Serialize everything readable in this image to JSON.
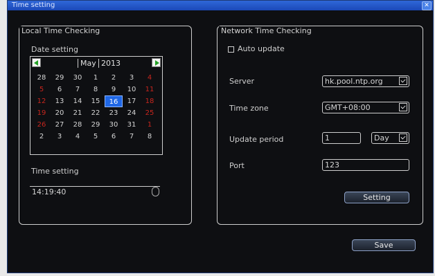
{
  "window": {
    "title": "Time setting",
    "close_icon": "close-icon"
  },
  "local": {
    "group_title": "Local Time Checking",
    "date_label": "Date setting",
    "month": "May",
    "year": "2013",
    "calendar": [
      [
        {
          "d": "28"
        },
        {
          "d": "29"
        },
        {
          "d": "30"
        },
        {
          "d": "1"
        },
        {
          "d": "2"
        },
        {
          "d": "3"
        },
        {
          "d": "4",
          "r": 1
        }
      ],
      [
        {
          "d": "5",
          "r": 1
        },
        {
          "d": "6"
        },
        {
          "d": "7"
        },
        {
          "d": "8"
        },
        {
          "d": "9"
        },
        {
          "d": "10"
        },
        {
          "d": "11",
          "r": 1
        }
      ],
      [
        {
          "d": "12",
          "r": 1
        },
        {
          "d": "13"
        },
        {
          "d": "14"
        },
        {
          "d": "15"
        },
        {
          "d": "16",
          "s": 1
        },
        {
          "d": "17"
        },
        {
          "d": "18",
          "r": 1
        }
      ],
      [
        {
          "d": "19",
          "r": 1
        },
        {
          "d": "20"
        },
        {
          "d": "21"
        },
        {
          "d": "22"
        },
        {
          "d": "23"
        },
        {
          "d": "24"
        },
        {
          "d": "25",
          "r": 1
        }
      ],
      [
        {
          "d": "26",
          "r": 1
        },
        {
          "d": "27"
        },
        {
          "d": "28"
        },
        {
          "d": "29"
        },
        {
          "d": "30"
        },
        {
          "d": "31"
        },
        {
          "d": "1",
          "r": 1
        }
      ],
      [
        {
          "d": "2"
        },
        {
          "d": "3"
        },
        {
          "d": "4"
        },
        {
          "d": "5"
        },
        {
          "d": "6"
        },
        {
          "d": "7"
        },
        {
          "d": "8"
        }
      ]
    ],
    "time_label": "Time setting",
    "time_value": "14:19:40"
  },
  "network": {
    "group_title": "Network Time Checking",
    "auto_update_label": "Auto update",
    "auto_update_checked": false,
    "server_label": "Server",
    "server_value": "hk.pool.ntp.org",
    "timezone_label": "Time zone",
    "timezone_value": "GMT+08:00",
    "update_label": "Update period",
    "update_value": "1",
    "update_unit": "Day",
    "port_label": "Port",
    "port_value": "123",
    "setting_button": "Setting"
  },
  "save_button": "Save",
  "colors": {
    "title_bar": "#2353c4",
    "weekend": "#c8261e",
    "selected_day": "#1f67e6",
    "background": "#0e0f12"
  }
}
